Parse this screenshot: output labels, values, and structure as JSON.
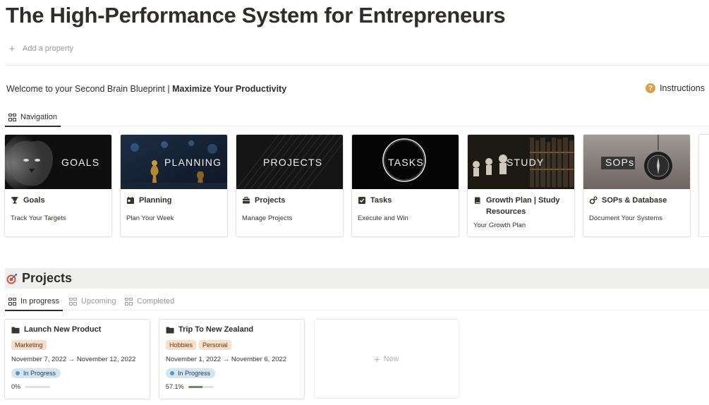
{
  "page": {
    "title": "The High-Performance System for Entrepreneurs",
    "add_property": "Add a property"
  },
  "welcome": {
    "prefix": "Welcome to your Second Brain Blueprint | ",
    "bold": "Maximize Your Productivity"
  },
  "instructions": {
    "label": "Instructions",
    "icon": "question-circle-icon"
  },
  "nav_tabs": [
    {
      "label": "Navigation",
      "icon": "grid-icon",
      "active": true
    }
  ],
  "nav_cards": [
    {
      "cover_word": "GOALS",
      "title": "Goals",
      "subtitle": "Track Your Targets",
      "icon": "trophy-icon"
    },
    {
      "cover_word": "PLANNING",
      "title": "Planning",
      "subtitle": "Plan Your Week",
      "icon": "calendar-icon"
    },
    {
      "cover_word": "PROJECTS",
      "title": "Projects",
      "subtitle": "Manage Projects",
      "icon": "briefcase-icon"
    },
    {
      "cover_word": "TASKS",
      "title": "Tasks",
      "subtitle": "Execute and Win",
      "icon": "checkbox-icon"
    },
    {
      "cover_word": "STUDY",
      "title": "Growth Plan | Study Resources",
      "subtitle": "Your Growth Plan",
      "icon": "book-icon"
    },
    {
      "cover_word": "SOPs",
      "title": "SOPs & Database",
      "subtitle": "Document Your Systems",
      "icon": "gears-icon"
    }
  ],
  "projects_section": {
    "title": "Projects",
    "icon": "target-icon",
    "tabs": [
      {
        "label": "In progress",
        "active": true
      },
      {
        "label": "Upcoming",
        "active": false
      },
      {
        "label": "Completed",
        "active": false
      }
    ],
    "cards": [
      {
        "title": "Launch New Product",
        "tags": [
          "Marketing"
        ],
        "dates": "November 7, 2022 → November 12, 2022",
        "status": "In Progress",
        "progress_label": "0%",
        "progress_value": 0
      },
      {
        "title": "Trip To New Zealand",
        "tags": [
          "Hobbies",
          "Personal"
        ],
        "dates": "November 1, 2022 → November 6, 2022",
        "status": "In Progress",
        "progress_label": "57.1%",
        "progress_value": 0.571
      }
    ],
    "new_label": "New"
  },
  "colors": {
    "tag_bg": "#fadec9",
    "status_bg": "#d3e5ef",
    "status_dot": "#5b97bd",
    "progress_fill": "#6c8a6a",
    "section_bg": "#efefed"
  }
}
